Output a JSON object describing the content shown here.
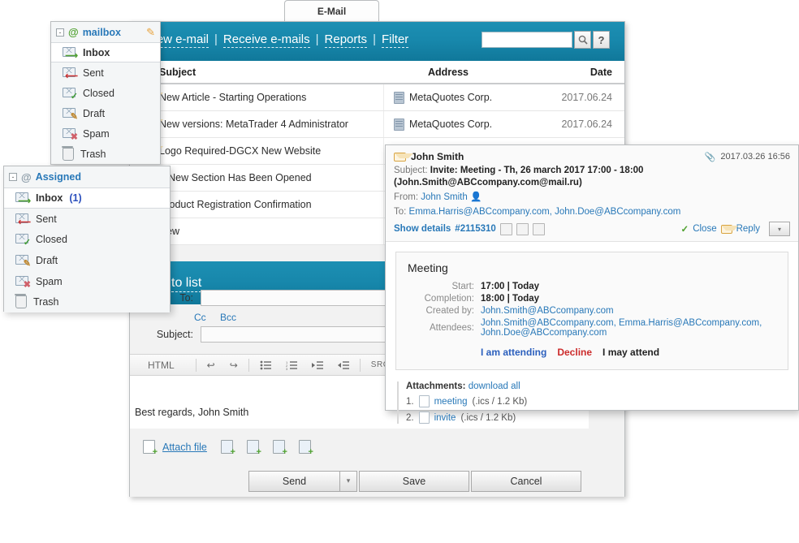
{
  "tab": {
    "label": "E-Mail"
  },
  "toolbar": {
    "links": [
      "New e-mail",
      "Receive e-mails",
      "Reports",
      "Filter"
    ],
    "separator": "|",
    "search_value": "",
    "search_placeholder": "",
    "search_icon": "search-icon",
    "help_label": "?"
  },
  "list": {
    "columns": {
      "subject": "Subject",
      "address": "Address",
      "date": "Date"
    },
    "rows": [
      {
        "subject": "New Article - Starting Operations",
        "address": "MetaQuotes Corp.",
        "date": "2017.06.24"
      },
      {
        "subject": "New versions: MetaTrader 4 Administrator",
        "address": "MetaQuotes Corp.",
        "date": "2017.06.24"
      },
      {
        "subject": "Logo Required-DGCX New Website",
        "address": "",
        "date": ""
      },
      {
        "subject": "A New Section Has Been Opened",
        "address": "",
        "date": ""
      },
      {
        "subject": "Product Registration Confirmation",
        "address": "",
        "date": ""
      },
      {
        "subject": "New",
        "address": "",
        "date": ""
      }
    ]
  },
  "mailbox_tree": {
    "title": "mailbox",
    "at_icon": "@",
    "edit_icon": "pencil-icon",
    "collapse": "-",
    "items": [
      {
        "label": "Inbox",
        "count": "",
        "icon": "inbox-icon",
        "selected": true
      },
      {
        "label": "Sent",
        "count": "",
        "icon": "sent-icon",
        "selected": false
      },
      {
        "label": "Closed",
        "count": "",
        "icon": "closed-icon",
        "selected": false
      },
      {
        "label": "Draft",
        "count": "",
        "icon": "draft-icon",
        "selected": false
      },
      {
        "label": "Spam",
        "count": "",
        "icon": "spam-icon",
        "selected": false
      },
      {
        "label": "Trash",
        "count": "",
        "icon": "trash-icon",
        "selected": false
      }
    ]
  },
  "assigned_tree": {
    "title": "Assigned",
    "at_icon": "@",
    "collapse": "-",
    "items": [
      {
        "label": "Inbox",
        "count": "(1)",
        "icon": "inbox-icon",
        "selected": true
      },
      {
        "label": "Sent",
        "count": "",
        "icon": "sent-icon",
        "selected": false
      },
      {
        "label": "Closed",
        "count": "",
        "icon": "closed-icon",
        "selected": false
      },
      {
        "label": "Draft",
        "count": "",
        "icon": "draft-icon",
        "selected": false
      },
      {
        "label": "Spam",
        "count": "",
        "icon": "spam-icon",
        "selected": false
      },
      {
        "label": "Trash",
        "count": "",
        "icon": "trash-icon",
        "selected": false
      }
    ]
  },
  "compose": {
    "header_link": "to list",
    "to_label": "To:",
    "to_value": "",
    "cc_label": "Cc",
    "bcc_label": "Bcc",
    "subject_label": "Subject:",
    "subject_value": "",
    "editor": {
      "mode_label": "HTML",
      "undo_icon": "undo-arrow-icon",
      "redo_icon": "redo-arrow-icon",
      "bullet_list_icon": "bullet-list-icon",
      "numbered_list_icon": "numbered-list-icon",
      "indent_icon": "indent-icon",
      "outdent_icon": "outdent-icon",
      "src_label": "SRC",
      "video_icon": "video-icon",
      "table_icon": "table-icon",
      "link_icon": "link-icon"
    },
    "body_text": "Best regards, John Smith",
    "attach_label": "Attach file",
    "attach_extra_icons": [
      "add-image-icon",
      "add-document-icon",
      "add-chart-icon",
      "add-structure-icon"
    ],
    "buttons": {
      "send": "Send",
      "send_arrow": "▾",
      "save": "Save",
      "cancel": "Cancel"
    }
  },
  "detail": {
    "sender": "John Smith",
    "timestamp": "2017.03.26 16:56",
    "attachment_icon": "paperclip-icon",
    "subject_label": "Subject:",
    "subject_value": "Invite: Meeting - Th, 26 march 2017 17:00 - 18:00 (John.Smith@ABCcompany.com@mail.ru)",
    "from_label": "From:",
    "from_value": "John Smith",
    "from_icon": "user-add-icon",
    "to_label": "To:",
    "to_value": "Emma.Harris@ABCcompany.com, John.Doe@ABCcompany.com",
    "show_details": "Show details",
    "ticket_id": "#2115310",
    "action_icons": [
      "print-icon",
      "copy-icon",
      "forward-icon"
    ],
    "close_label": "Close",
    "close_icon": "check-icon",
    "reply_label": "Reply",
    "reply_icon": "reply-icon",
    "dropdown_icon": "▾",
    "invite": {
      "title": "Meeting",
      "start_label": "Start:",
      "start_value": "17:00 | Today",
      "completion_label": "Completion:",
      "completion_value": "18:00 | Today",
      "created_by_label": "Created by:",
      "created_by_value": "John.Smith@ABCcompany.com",
      "attendees_label": "Attendees:",
      "attendees_line1": "John.Smith@ABCcompany.com, Emma.Harris@ABCcompany.com,",
      "attendees_line2": "John.Doe@ABCcompany.com",
      "respond_yes": "I am attending",
      "respond_no": "Decline",
      "respond_maybe": "I may attend"
    },
    "attachments": {
      "label": "Attachments:",
      "download_all": "download all",
      "items": [
        {
          "num": "1.",
          "name": "meeting",
          "meta": "(.ics / 1.2 Kb)"
        },
        {
          "num": "2.",
          "name": "invite",
          "meta": "(.ics / 1.2 Kb)"
        }
      ]
    }
  },
  "colors": {
    "teal": "#1787ab",
    "link_blue": "#2878b8",
    "green": "#4fa12f",
    "red": "#cc2b2b",
    "count_blue": "#2b4fbd"
  }
}
